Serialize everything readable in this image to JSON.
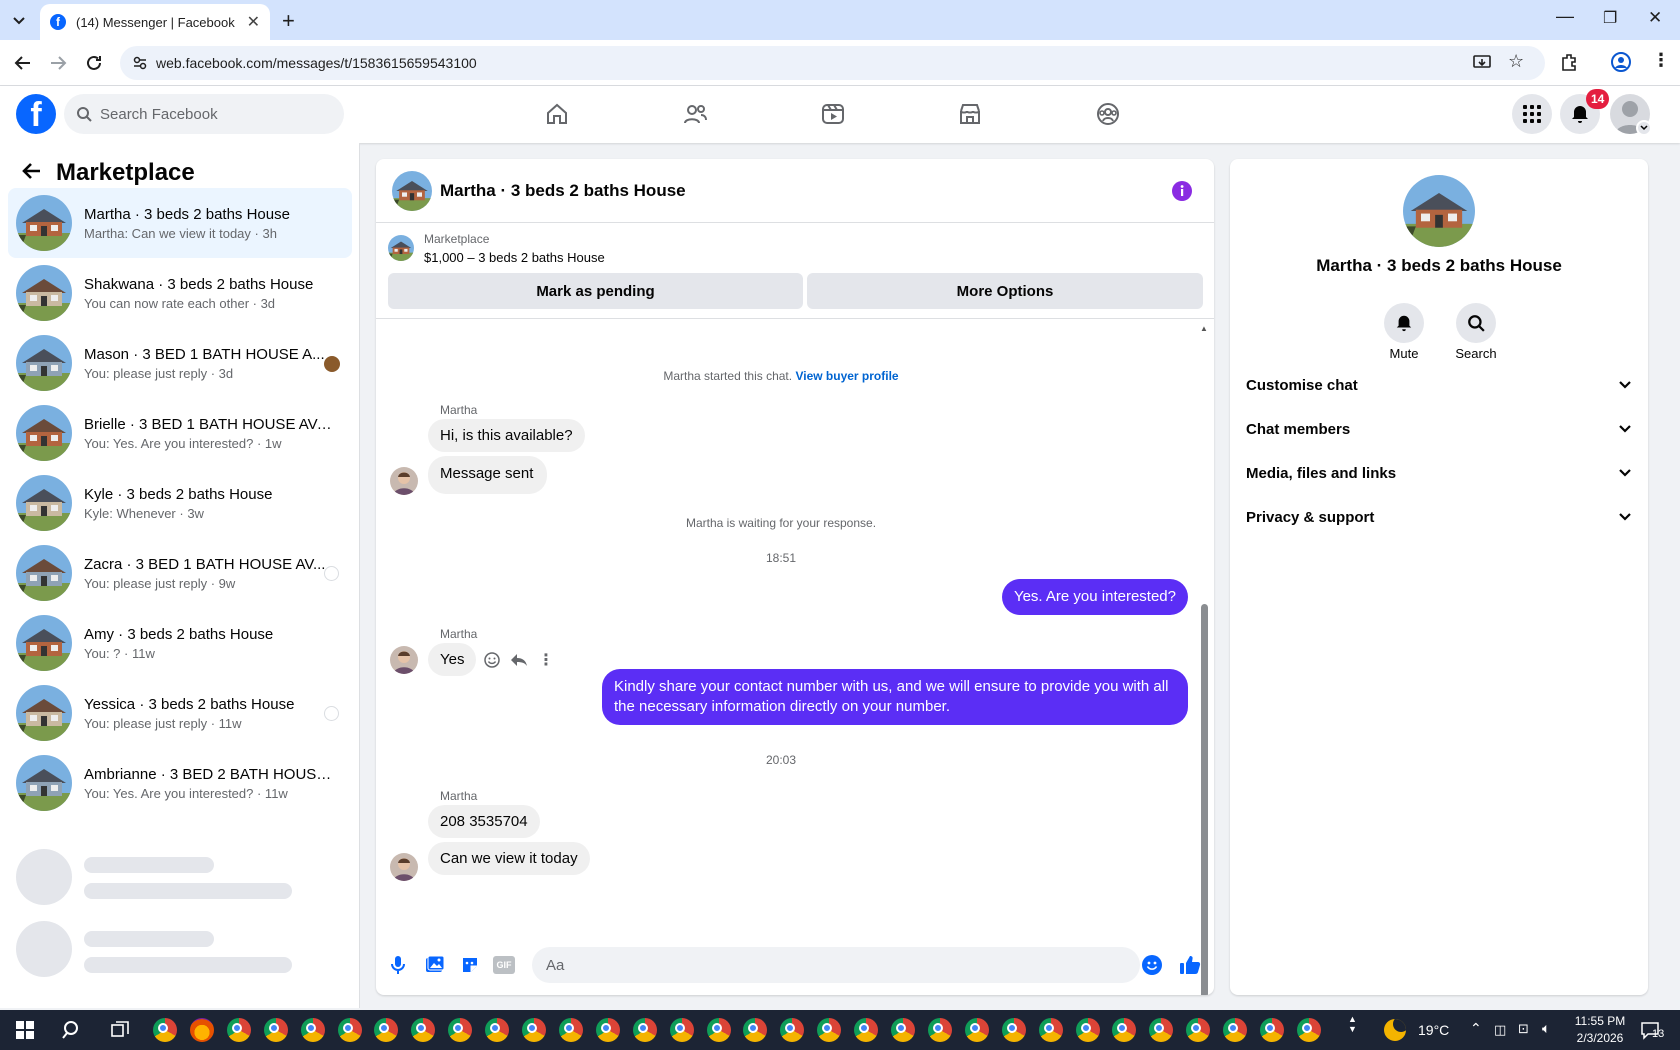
{
  "browser": {
    "tab_title": "(14) Messenger | Facebook",
    "url": "web.facebook.com/messages/t/1583615659543100"
  },
  "header": {
    "search_placeholder": "Search Facebook",
    "notification_count": "14"
  },
  "sidebar": {
    "title": "Marketplace",
    "conversations": [
      {
        "name": "Martha · 3 beds 2 baths House",
        "preview": "Martha: Can we view it today · 3h"
      },
      {
        "name": "Shakwana · 3 beds 2 baths House",
        "preview": "You can now rate each other · 3d"
      },
      {
        "name": "Mason · 3 BED 1 BATH HOUSE A...",
        "preview": "You: please just reply · 3d"
      },
      {
        "name": "Brielle · 3 BED 1 BATH HOUSE AVAI...",
        "preview": "You: Yes. Are you interested? · 1w"
      },
      {
        "name": "Kyle · 3 beds 2 baths House",
        "preview": "Kyle: Whenever · 3w"
      },
      {
        "name": "Zacra · 3 BED 1 BATH HOUSE AV...",
        "preview": "You: please just reply · 9w"
      },
      {
        "name": "Amy · 3 beds 2 baths House",
        "preview": "You: ? · 11w"
      },
      {
        "name": "Yessica · 3 beds 2 baths House",
        "preview": "You: please just reply · 11w"
      },
      {
        "name": "Ambrianne · 3 BED 2 BATH HOUSE...",
        "preview": "You: Yes. Are you interested? · 11w"
      }
    ]
  },
  "chat": {
    "title": "Martha · 3 beds 2 baths House",
    "marketplace_label": "Marketplace",
    "listing": "$1,000 – 3 beds 2 baths House",
    "mark_pending": "Mark as pending",
    "more_options": "More Options",
    "started": "Martha started this chat.",
    "view_profile": "View buyer profile",
    "sender": "Martha",
    "msg1": "Hi, is this available?",
    "msg2": "Message sent",
    "waiting": "Martha is waiting for your response.",
    "time1": "18:51",
    "out1": "Yes. Are you interested?",
    "msg3": "Yes",
    "out2": "Kindly share your contact number with us, and we will ensure to provide you with all the necessary information directly on your number.",
    "time2": "20:03",
    "msg4": "208 3535704",
    "msg5": "Can we view it today",
    "input_placeholder": "Aa"
  },
  "right_panel": {
    "name": "Martha · 3 beds 2 baths House",
    "mute": "Mute",
    "search": "Search",
    "sections": [
      "Customise chat",
      "Chat members",
      "Media, files and links",
      "Privacy & support"
    ]
  },
  "taskbar": {
    "temperature": "19°C",
    "time": "11:55 PM",
    "date": "2/3/2026",
    "notif": "13"
  },
  "colors": {
    "accent": "#5b2ef5",
    "fb_blue": "#0866ff",
    "badge_red": "#e41e3f"
  }
}
